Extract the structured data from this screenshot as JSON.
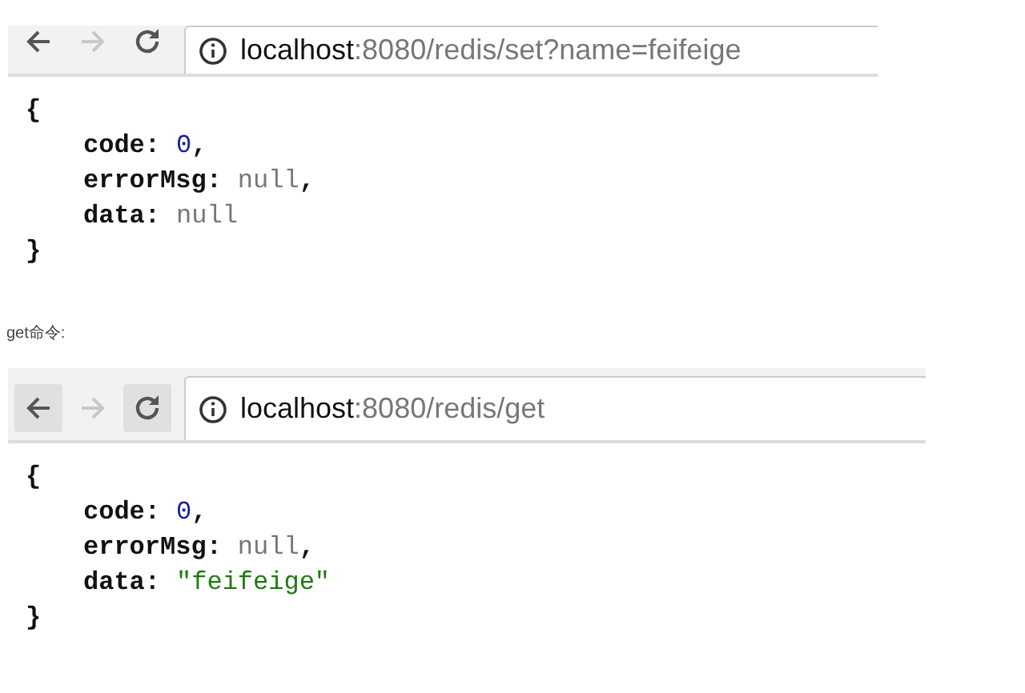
{
  "panels": [
    {
      "toolbar": {
        "buttons": [
          {
            "kind": "back",
            "disabled": false,
            "highlighted": false
          },
          {
            "kind": "forward",
            "disabled": true,
            "highlighted": false
          },
          {
            "kind": "reload",
            "disabled": false,
            "highlighted": false
          }
        ],
        "url": {
          "host": "localhost",
          "rest": ":8080/redis/set?name=feifeige"
        }
      },
      "body": {
        "open": "{",
        "close": "}",
        "lines": [
          {
            "key": "code:",
            "value": "0",
            "kind": "number",
            "comma": ","
          },
          {
            "key": "errorMsg:",
            "value": "null",
            "kind": "null",
            "comma": ","
          },
          {
            "key": "data:",
            "value": "null",
            "kind": "null"
          }
        ]
      }
    },
    {
      "caption": "get命令:",
      "toolbar": {
        "buttons": [
          {
            "kind": "back",
            "disabled": false,
            "highlighted": true
          },
          {
            "kind": "forward",
            "disabled": true,
            "highlighted": false
          },
          {
            "kind": "reload",
            "disabled": false,
            "highlighted": true
          }
        ],
        "url": {
          "host": "localhost",
          "rest": ":8080/redis/get"
        }
      },
      "body": {
        "open": "{",
        "close": "}",
        "lines": [
          {
            "key": "code:",
            "value": "0",
            "kind": "number",
            "comma": ","
          },
          {
            "key": "errorMsg:",
            "value": "null",
            "kind": "null",
            "comma": ","
          },
          {
            "key": "data:",
            "value": "\"feifeige\"",
            "kind": "string"
          }
        ]
      }
    }
  ]
}
